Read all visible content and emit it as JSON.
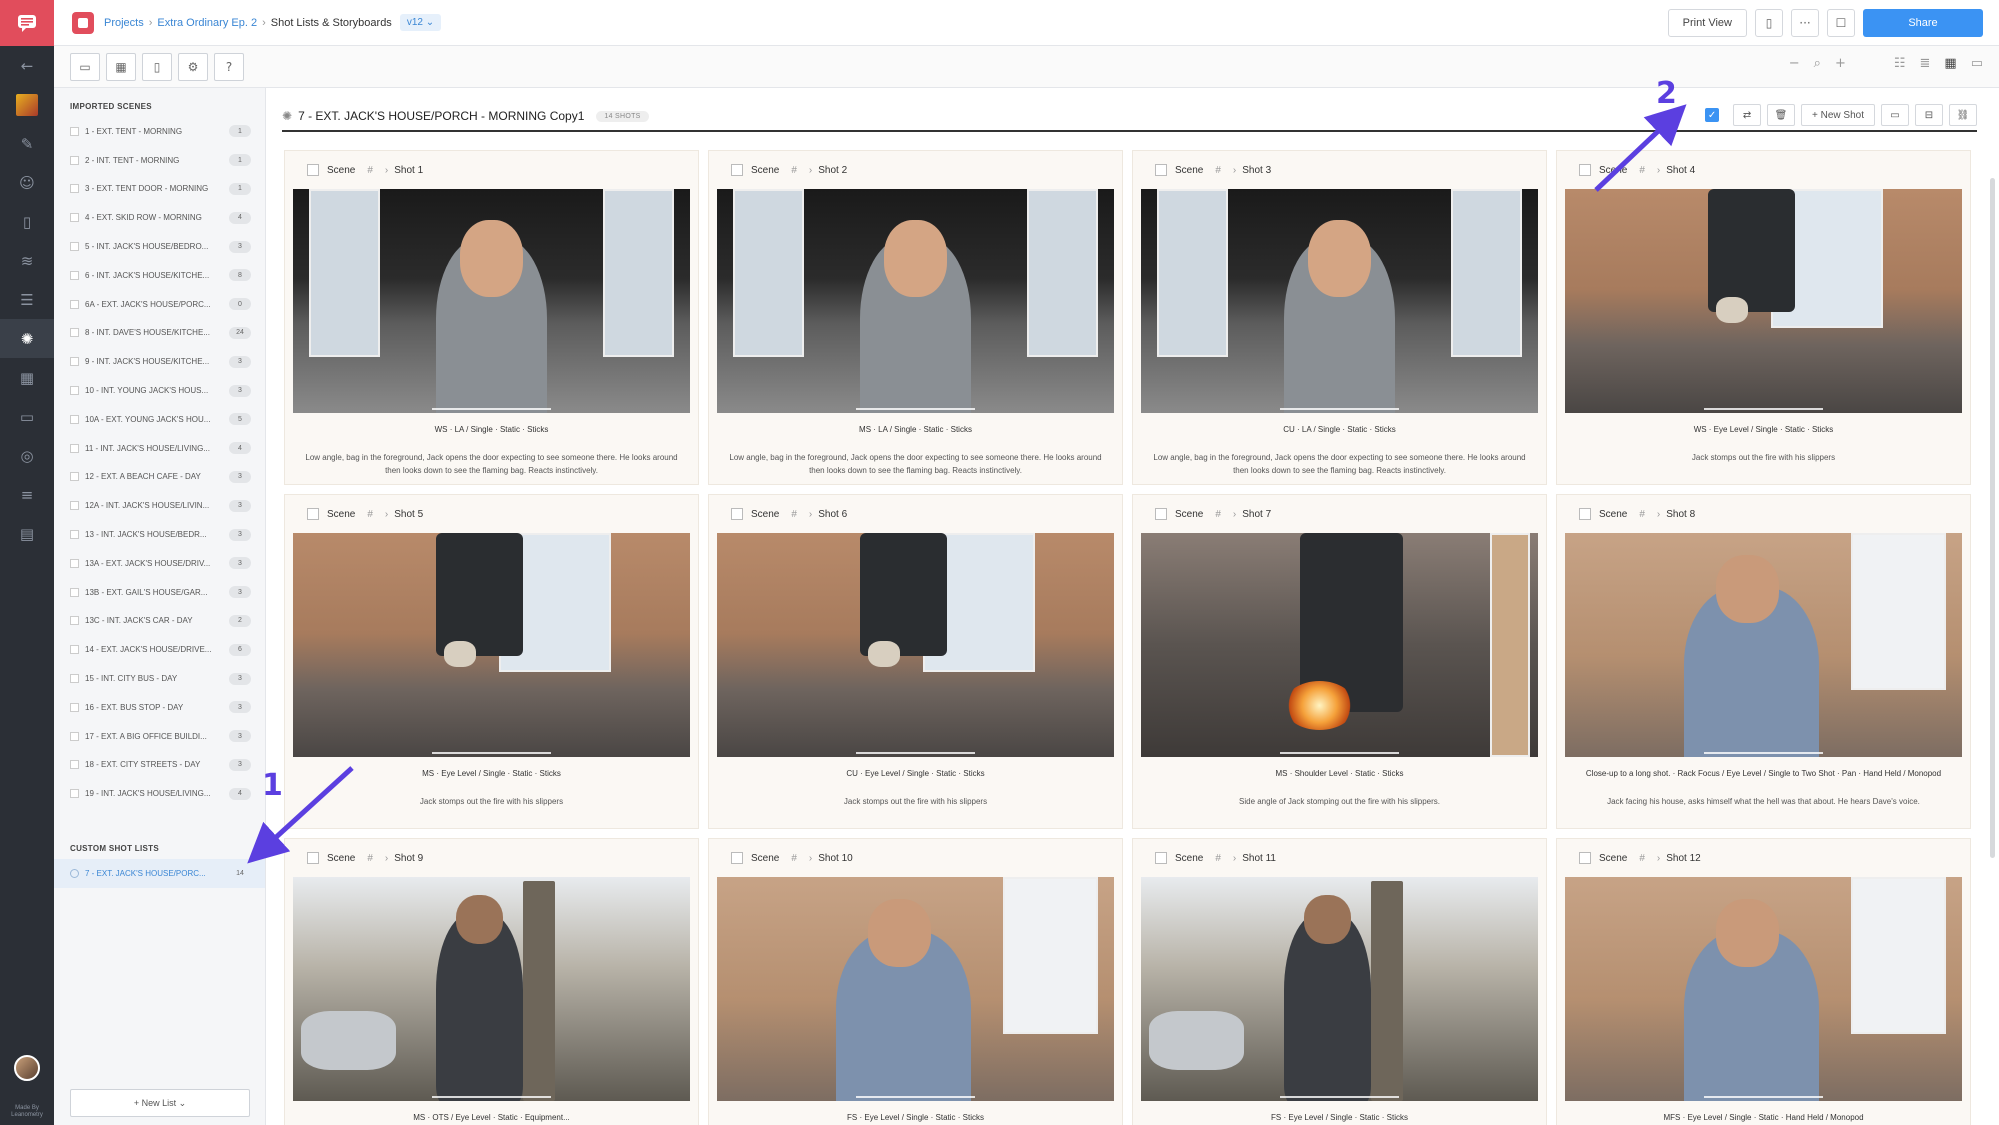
{
  "app": {
    "breadcrumb": [
      "Projects",
      "Extra Ordinary Ep. 2",
      "Shot Lists & Storyboards"
    ],
    "version": "v12 ⌄",
    "print_view": "Print View",
    "share": "Share",
    "brand_color": "#e14d5c",
    "accent_color": "#3b93f3"
  },
  "rail": {
    "icons": [
      "back-arrow-icon",
      "project-thumb-icon",
      "pencil-icon",
      "people-icon",
      "book-icon",
      "layers-icon",
      "list-icon",
      "film-reel-icon",
      "calendar-icon",
      "folder-icon",
      "map-pin-icon",
      "sliders-icon",
      "board-icon"
    ],
    "made_by": "Made By Leanometry"
  },
  "sidebar": {
    "imported_heading": "IMPORTED SCENES",
    "scenes": [
      {
        "label": "1 - EXT. TENT - MORNING",
        "count": "1"
      },
      {
        "label": "2 - INT. TENT - MORNING",
        "count": "1"
      },
      {
        "label": "3 - EXT. TENT DOOR - MORNING",
        "count": "1"
      },
      {
        "label": "4 - EXT. SKID ROW - MORNING",
        "count": "4"
      },
      {
        "label": "5 - INT. JACK'S HOUSE/BEDRO...",
        "count": "3"
      },
      {
        "label": "6 - INT. JACK'S HOUSE/KITCHE...",
        "count": "8"
      },
      {
        "label": "6A - EXT. JACK'S HOUSE/PORC...",
        "count": "0"
      },
      {
        "label": "8 - INT. DAVE'S HOUSE/KITCHE...",
        "count": "24"
      },
      {
        "label": "9 - INT. JACK'S HOUSE/KITCHE...",
        "count": "3"
      },
      {
        "label": "10 - INT. YOUNG JACK'S HOUS...",
        "count": "3"
      },
      {
        "label": "10A - EXT. YOUNG JACK'S HOU...",
        "count": "5"
      },
      {
        "label": "11 - INT. JACK'S HOUSE/LIVING...",
        "count": "4"
      },
      {
        "label": "12 - EXT. A BEACH CAFE - DAY",
        "count": "3"
      },
      {
        "label": "12A - INT. JACK'S HOUSE/LIVIN...",
        "count": "3"
      },
      {
        "label": "13 - INT. JACK'S HOUSE/BEDR...",
        "count": "3"
      },
      {
        "label": "13A - EXT. JACK'S HOUSE/DRIV...",
        "count": "3"
      },
      {
        "label": "13B - EXT. GAIL'S HOUSE/GAR...",
        "count": "3"
      },
      {
        "label": "13C - INT. JACK'S CAR - DAY",
        "count": "2"
      },
      {
        "label": "14 - EXT. JACK'S HOUSE/DRIVE...",
        "count": "6"
      },
      {
        "label": "15 - INT. CITY BUS - DAY",
        "count": "3"
      },
      {
        "label": "16 - EXT. BUS STOP - DAY",
        "count": "3"
      },
      {
        "label": "17 - EXT. A BIG OFFICE BUILDI...",
        "count": "3"
      },
      {
        "label": "18 - EXT. CITY STREETS - DAY",
        "count": "3"
      },
      {
        "label": "19 - INT. JACK'S HOUSE/LIVING...",
        "count": "4"
      }
    ],
    "custom_heading": "CUSTOM SHOT LISTS",
    "custom": [
      {
        "label": "7 - EXT. JACK'S HOUSE/PORC...",
        "count": "14"
      }
    ],
    "new_list": "+ New List ⌄"
  },
  "list": {
    "title": "7 - EXT. JACK'S HOUSE/PORCH - MORNING Copy1",
    "shots_badge": "14 SHOTS",
    "new_shot": "+ New Shot"
  },
  "annotations": {
    "one": "1",
    "two": "2"
  },
  "cards": [
    {
      "scene": "Scene",
      "hash": "#",
      "shot": "Shot 1",
      "meta": "WS · LA / Single · Static · Sticks",
      "desc": "Low angle, bag in the foreground, Jack opens the door expecting to see someone there. He looks around then looks down to see the flaming bag. Reacts instinctively.",
      "img": "indoor"
    },
    {
      "scene": "Scene",
      "hash": "#",
      "shot": "Shot 2",
      "meta": "MS · LA / Single · Static · Sticks",
      "desc": "Low angle, bag in the foreground, Jack opens the door expecting to see someone there. He looks around then looks down to see the flaming bag. Reacts instinctively.",
      "img": "indoor"
    },
    {
      "scene": "Scene",
      "hash": "#",
      "shot": "Shot 3",
      "meta": "CU · LA / Single · Static · Sticks",
      "desc": "Low angle, bag in the foreground, Jack opens the door expecting to see someone there. He looks around then looks down to see the flaming bag. Reacts instinctively.",
      "img": "indoor"
    },
    {
      "scene": "Scene",
      "hash": "#",
      "shot": "Shot 4",
      "meta": "WS · Eye Level / Single · Static · Sticks",
      "desc": "Jack stomps out the fire with his slippers",
      "img": "porch"
    },
    {
      "scene": "Scene",
      "hash": "#",
      "shot": "Shot 5",
      "meta": "MS · Eye Level / Single · Static · Sticks",
      "desc": "Jack stomps out the fire with his slippers",
      "img": "porch"
    },
    {
      "scene": "Scene",
      "hash": "#",
      "shot": "Shot 6",
      "meta": "CU · Eye Level / Single · Static · Sticks",
      "desc": "Jack stomps out the fire with his slippers",
      "img": "porch"
    },
    {
      "scene": "Scene",
      "hash": "#",
      "shot": "Shot 7",
      "meta": "MS · Shoulder Level · Static · Sticks",
      "desc": "Side angle of Jack stomping out the fire with his slippers.",
      "img": "porchfire"
    },
    {
      "scene": "Scene",
      "hash": "#",
      "shot": "Shot 8",
      "meta": "Close-up to a long shot. · Rack Focus / Eye Level / Single to Two Shot · Pan · Hand Held / Monopod",
      "desc": "Jack facing his house, asks himself what the hell was that about. He hears Dave's voice.",
      "img": "wall"
    },
    {
      "scene": "Scene",
      "hash": "#",
      "shot": "Shot 9",
      "meta": "MS · OTS / Eye Level · Static · Equipment...",
      "desc": "",
      "img": "outside"
    },
    {
      "scene": "Scene",
      "hash": "#",
      "shot": "Shot 10",
      "meta": "FS · Eye Level / Single · Static · Sticks",
      "desc": "",
      "img": "wall"
    },
    {
      "scene": "Scene",
      "hash": "#",
      "shot": "Shot 11",
      "meta": "FS · Eye Level / Single · Static · Sticks",
      "desc": "",
      "img": "outside"
    },
    {
      "scene": "Scene",
      "hash": "#",
      "shot": "Shot 12",
      "meta": "MFS · Eye Level / Single · Static · Hand Held / Monopod",
      "desc": "",
      "img": "wall"
    }
  ]
}
